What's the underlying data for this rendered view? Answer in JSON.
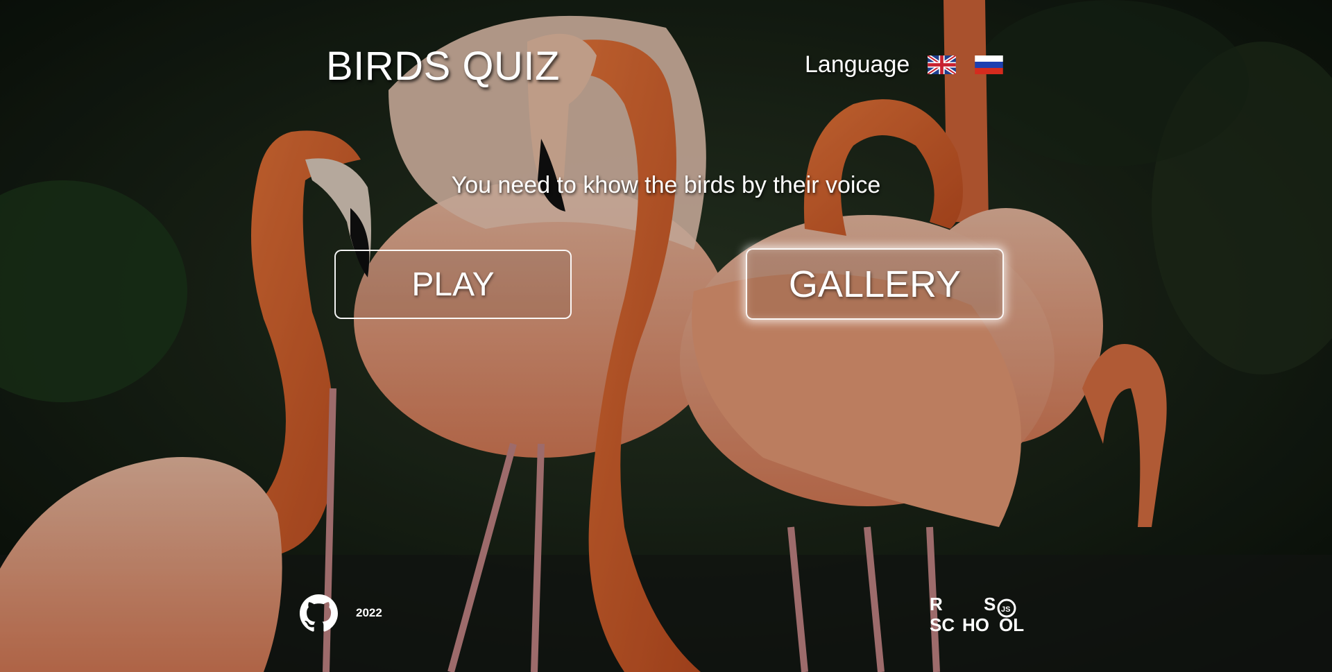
{
  "header": {
    "title": "BIRDS QUIZ",
    "language_label": "Language",
    "languages": [
      {
        "icon": "uk-flag-icon"
      },
      {
        "icon": "russia-flag-icon"
      }
    ]
  },
  "main": {
    "subtitle": "You need to khow the birds by their voice",
    "play_label": "PLAY",
    "gallery_label": "GALLERY"
  },
  "footer": {
    "github_icon": "github-icon",
    "year": "2022",
    "school_logo_icon": "rs-school-logo-icon"
  },
  "colors": {
    "text": "#ffffff",
    "background": "#101a12",
    "flamingo": "#e8723c"
  }
}
